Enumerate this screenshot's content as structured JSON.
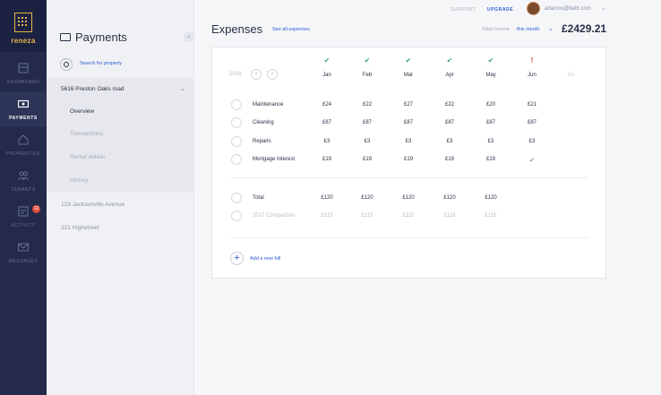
{
  "brand": {
    "name": "reneza"
  },
  "nav": {
    "items": [
      {
        "label": "DASHBOARD",
        "icon": "dashboard-icon"
      },
      {
        "label": "PAYMENTS",
        "icon": "payments-icon"
      },
      {
        "label": "PROPERTIES",
        "icon": "properties-icon"
      },
      {
        "label": "TENANTS",
        "icon": "tenants-icon"
      },
      {
        "label": "ACTIVITY",
        "icon": "activity-icon",
        "badge": "12"
      },
      {
        "label": "MESSAGES",
        "icon": "messages-icon"
      }
    ],
    "active": "PAYMENTS"
  },
  "sidebar": {
    "title": "Payments",
    "search_label": "Search for property",
    "properties": [
      {
        "name": "5616 Preston Oaks road",
        "expanded": true,
        "sub": [
          "Overview",
          "Transactions",
          "Rental details",
          "History"
        ],
        "active_sub": "Overview"
      },
      {
        "name": "123 Jacksonville Avenue"
      },
      {
        "name": "321 Highstreet"
      }
    ]
  },
  "topbar": {
    "support": "SUPPORT",
    "upgrade": "UPGRADE",
    "email": "adamos@beltr.com"
  },
  "header": {
    "title": "Expenses",
    "see_all": "See all expenses",
    "income_label": "Total income",
    "period": "this month",
    "amount": "£2429.21"
  },
  "table": {
    "year": "2018",
    "months": [
      "Jan",
      "Feb",
      "Mar",
      "Apr",
      "May",
      "Jun",
      "Jul"
    ],
    "status": [
      "ok",
      "ok",
      "ok",
      "ok",
      "ok",
      "warn",
      ""
    ],
    "rows": [
      {
        "label": "Maintenance",
        "icon": "maintenance-icon",
        "values": [
          "£24",
          "£22",
          "£27",
          "£22",
          "£20",
          "£21"
        ]
      },
      {
        "label": "Cleaning",
        "icon": "cleaning-icon",
        "values": [
          "£87",
          "£87",
          "£87",
          "£87",
          "£87",
          "£87"
        ]
      },
      {
        "label": "Repairs",
        "icon": "repairs-icon",
        "values": [
          "£3",
          "£3",
          "£3",
          "£3",
          "£3",
          "£3"
        ]
      },
      {
        "label": "Mortgage Interest",
        "icon": "home-icon",
        "values": [
          "£19",
          "£19",
          "£19",
          "£19",
          "£19",
          "✔"
        ]
      }
    ],
    "total": {
      "label": "Total",
      "values": [
        "£120",
        "£120",
        "£120",
        "£120",
        "£120"
      ]
    },
    "comparison": {
      "label": "2017 Comparison",
      "values": [
        "£115",
        "£115",
        "£115",
        "£115",
        "£115"
      ]
    },
    "add_bill": "Add a new bill",
    "colors": {
      "ok": "#39a86a",
      "warn": "#e24d3d",
      "accent": "#2f5bd4"
    }
  }
}
